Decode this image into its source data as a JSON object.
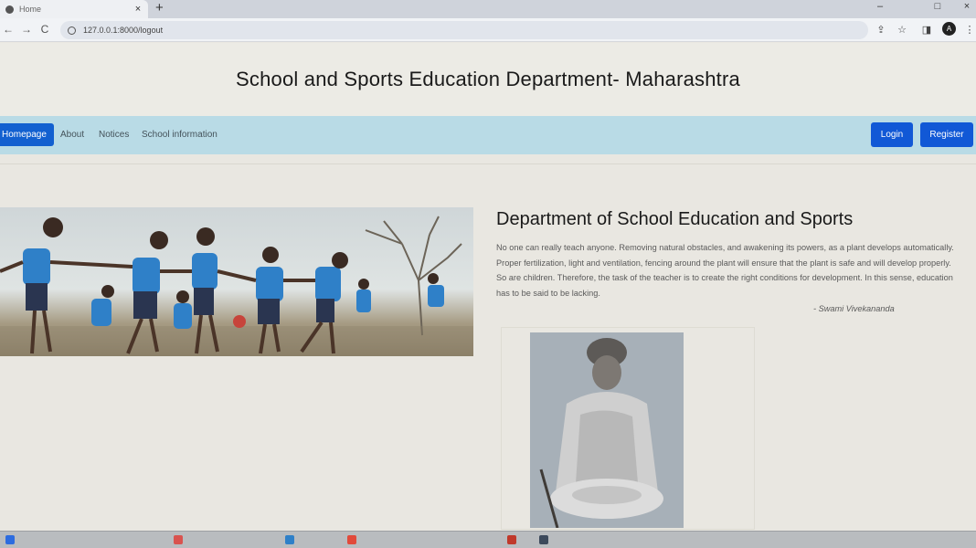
{
  "browser": {
    "tab_title": "Home",
    "tab_close": "×",
    "new_tab": "+",
    "url": "127.0.0.1:8000/logout",
    "back": "←",
    "forward": "→",
    "reload": "C",
    "profile_initial": "A",
    "window_controls": [
      "–",
      "□",
      "×"
    ]
  },
  "page": {
    "header_title": "School and Sports Education Department- Maharashtra",
    "nav": {
      "home": "Homepage",
      "links": [
        "About",
        "Notices",
        "School information"
      ],
      "login": "Login",
      "register": "Register"
    },
    "section_heading": "Department of School Education and Sports",
    "quote": "No one can really teach anyone. Removing natural obstacles, and awakening its powers, as a plant develops automatically. Proper fertilization, light and ventilation, fencing around the plant will ensure that the plant is safe and will develop properly. So are children. Therefore, the task of the teacher is to create the right conditions for development. In this sense, education has to be said to be lacking.",
    "quote_author": "- Swami Vivekananda"
  },
  "colors": {
    "primary_button": "#1158d6",
    "navbar": "#b9dbe6",
    "page_background": "#e9e7e1"
  },
  "icons": [
    "info-icon",
    "share-icon",
    "star-icon",
    "sidebar-icon",
    "menu-icon"
  ]
}
